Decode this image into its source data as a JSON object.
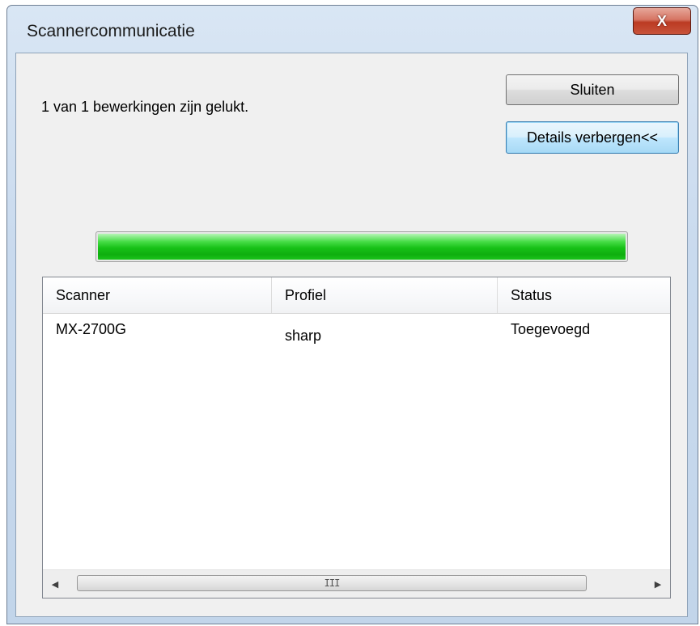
{
  "window": {
    "title": "Scannercommunicatie",
    "close_glyph": "X"
  },
  "summary": {
    "message": "1 van 1 bewerkingen zijn gelukt."
  },
  "buttons": {
    "close_label": "Sluiten",
    "details_label": "Details verbergen<<"
  },
  "progress": {
    "percent": 100,
    "color": "#17c117"
  },
  "table": {
    "columns": [
      "Scanner",
      "Profiel",
      "Status"
    ],
    "rows": [
      {
        "scanner": "MX-2700G",
        "profile": "sharp",
        "status": "Toegevoegd"
      }
    ]
  },
  "scrollbar": {
    "left_arrow": "◀",
    "right_arrow": "▶",
    "grip": "III"
  }
}
